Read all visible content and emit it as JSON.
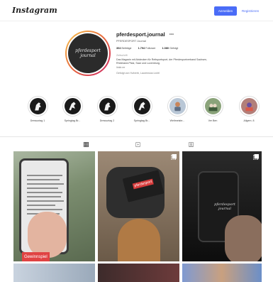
{
  "header": {
    "logo": "Instagram",
    "login_label": "Anmelden",
    "signup_label": "Registrieren"
  },
  "profile": {
    "avatar_text": "pferdesport",
    "avatar_subtext": "journal",
    "username": "pferdesport.journal",
    "subname": "PFERDESPORT Journal",
    "stats": {
      "posts": "304",
      "posts_label": "Beiträge",
      "followers": "1.794",
      "followers_label": "Follower",
      "following": "1.080",
      "following_label": "Gefolgt"
    },
    "category": "Zeitschrift",
    "bio": "Das Magazin mit Abdecken für Reitsportsport- der Pferdesportverband Sachsen, Rheinland-Pfalz, Saar und Luxemburg.",
    "link": "linktr.ee",
    "followed_by": "Gefolgt von Hufverb, Laurensius Lichtl"
  },
  "highlights": [
    {
      "label": "Dressurtag 1"
    },
    {
      "label": "Springtag Br..."
    },
    {
      "label": "Dressurtag 2"
    },
    {
      "label": "Springtag Br..."
    },
    {
      "label": "Weltmeiste..."
    },
    {
      "label": "Ver Ben"
    },
    {
      "label": "Allgem. 8"
    }
  ],
  "tabs": [
    {
      "name": "posts"
    },
    {
      "name": "reels"
    },
    {
      "name": "tagged"
    }
  ],
  "posts": {
    "tile1_caption": "Gewinnspiel",
    "tile2_card_logo": "pferdesport",
    "tile3_phone_logo": "pferdesport journal"
  },
  "colors": {
    "accent": "#4a6cf7",
    "story_ring_start": "#f7c84f",
    "story_ring_end": "#cc2366",
    "caption_red": "#e04343"
  }
}
